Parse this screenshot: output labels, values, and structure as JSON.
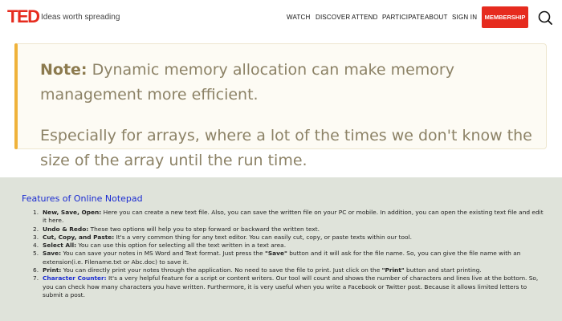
{
  "header": {
    "logo": "TED",
    "tagline": "Ideas worth spreading",
    "nav": [
      "WATCH",
      "DISCOVER",
      "ATTEND",
      "PARTICIPATE",
      "ABOUT",
      "SIGN IN"
    ],
    "membership_label": "MEMBERSHIP",
    "search_icon": "search-icon",
    "brand_color": "#e62b1e"
  },
  "note": {
    "label": "Note:",
    "line1": "Dynamic memory allocation can make memory management more efficient.",
    "line2": "Especially for arrays, where a lot of the times we don't know the size of the array until the run time.",
    "accent_color": "#efb23a"
  },
  "features": {
    "title": "Features of Online Notepad",
    "items": [
      {
        "num": "1.",
        "term": "New, Save, Open:",
        "text": " Here you can create a new text file. Also, you can save the written file on your PC or mobile. In addition, you can open the existing text file and edit it here."
      },
      {
        "num": "2.",
        "term": "Undo & Redo:",
        "text": " These two options will help you to step forward or backward the written text."
      },
      {
        "num": "3.",
        "term": "Cut, Copy, and Paste:",
        "text": " It's a very common thing for any text editor. You can easily cut, copy, or paste texts within our tool."
      },
      {
        "num": "4.",
        "term": "Select All:",
        "text": " You can use this option for selecting all the text written in a text area."
      },
      {
        "num": "5.",
        "term": "Save:",
        "text_a": " You can save your notes in MS Word and Text format. Just press the ",
        "bold": "\"Save\"",
        "text_b": " button and it will ask for the file name. So, you can give the file name with an extension(i.e. Filename.txt or Abc.doc) to save it."
      },
      {
        "num": "6.",
        "term": "Print:",
        "text_a": " You can directly print your notes through the application. No need to save the file to print. Just click on the ",
        "bold": "\"Print\"",
        "text_b": " button and start printing."
      },
      {
        "num": "7.",
        "term": "Character Counter:",
        "text": " It's a very helpful feature for a script or content writers. Our tool will count and shows the number of characters and lines live at the bottom. So, you can check how many characters you have written. Furthermore, it is very useful when you write a Facebook or Twitter post. Because it allows limited letters to submit a post."
      }
    ]
  }
}
